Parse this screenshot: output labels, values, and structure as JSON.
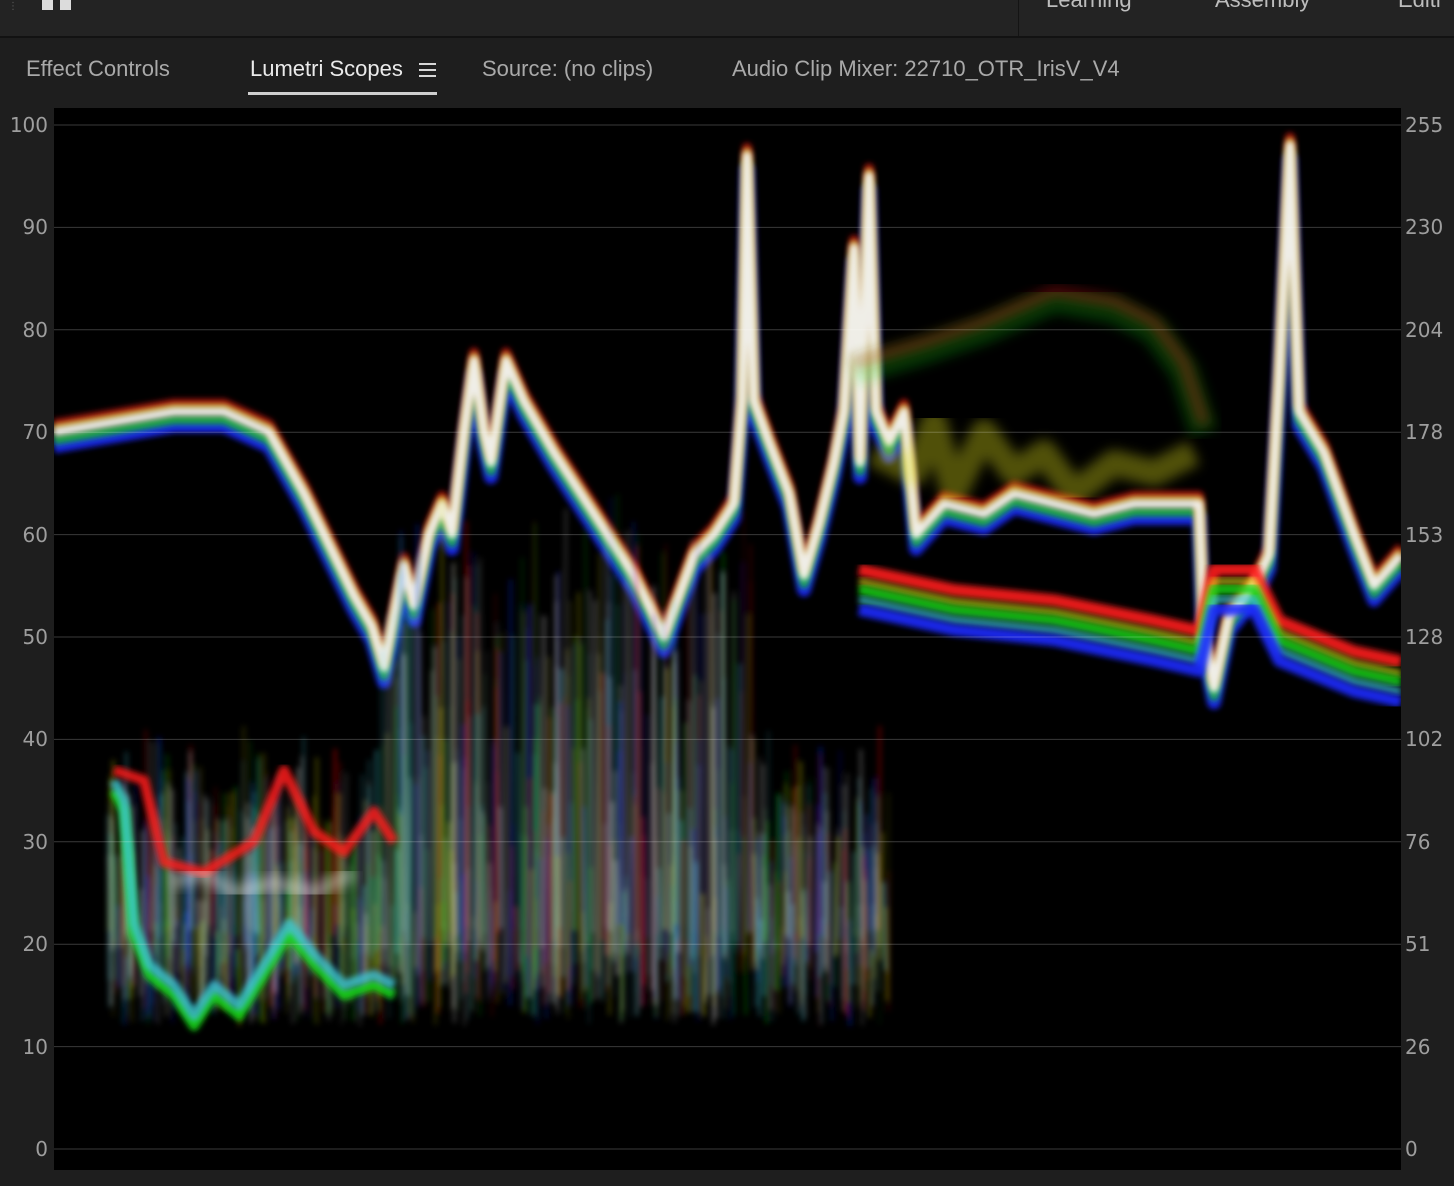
{
  "workspace_bar": {
    "tabs": [
      "Learning",
      "Assembly",
      "Editi"
    ]
  },
  "panel": {
    "tabs": [
      {
        "label": "Effect Controls"
      },
      {
        "label": "Lumetri Scopes"
      },
      {
        "label": "Source: (no clips)"
      },
      {
        "label": "Audio Clip Mixer: 22710_OTR_IrisV_V4"
      }
    ],
    "active_tab": "Lumetri Scopes",
    "menu_icon": "hamburger-menu-icon"
  },
  "scope": {
    "type": "RGB parade/waveform",
    "left_scale": [
      "100",
      "90",
      "80",
      "70",
      "60",
      "50",
      "40",
      "30",
      "20",
      "10",
      "0"
    ],
    "right_scale": [
      "255",
      "230",
      "204",
      "178",
      "153",
      "128",
      "102",
      "76",
      "51",
      "26",
      "0"
    ],
    "colors": {
      "red": "#ff1a1a",
      "green": "#19d419",
      "blue": "#1a2cff",
      "white": "#f2f2f2",
      "yellow": "#e6e61a",
      "cyan": "#40c8d8",
      "gridline": "#3a3a3a"
    }
  }
}
